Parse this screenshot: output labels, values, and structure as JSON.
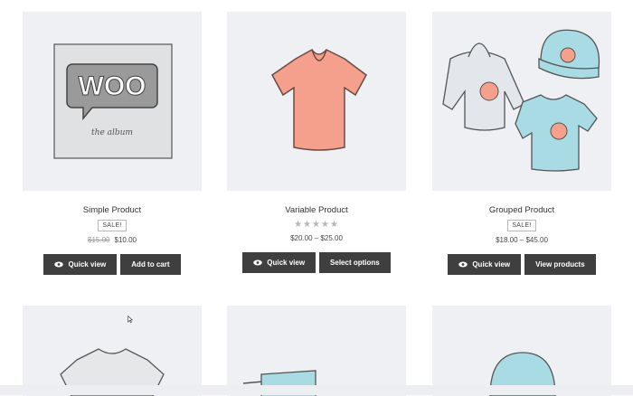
{
  "products": [
    {
      "title": "Simple Product",
      "badge": "SALE!",
      "price_old": "$15.00",
      "price_new": "$10.00",
      "buttons": [
        "Quick view",
        "Add to cart"
      ]
    },
    {
      "title": "Variable Product",
      "rating": "★★★★★",
      "price_range": "$20.00 – $25.00",
      "buttons": [
        "Quick view",
        "Select options"
      ]
    },
    {
      "title": "Grouped Product",
      "badge": "SALE!",
      "price_range": "$18.00 – $45.00",
      "buttons": [
        "Quick view",
        "View products"
      ]
    }
  ],
  "album_art": {
    "logo_text": "WOO",
    "caption": "the album"
  },
  "colors": {
    "thumb_bg": "#eef0f4",
    "button_bg": "#3f3f3f",
    "tshirt_pink": "#f4a08d",
    "apparel_blue": "#a8dbe4"
  }
}
